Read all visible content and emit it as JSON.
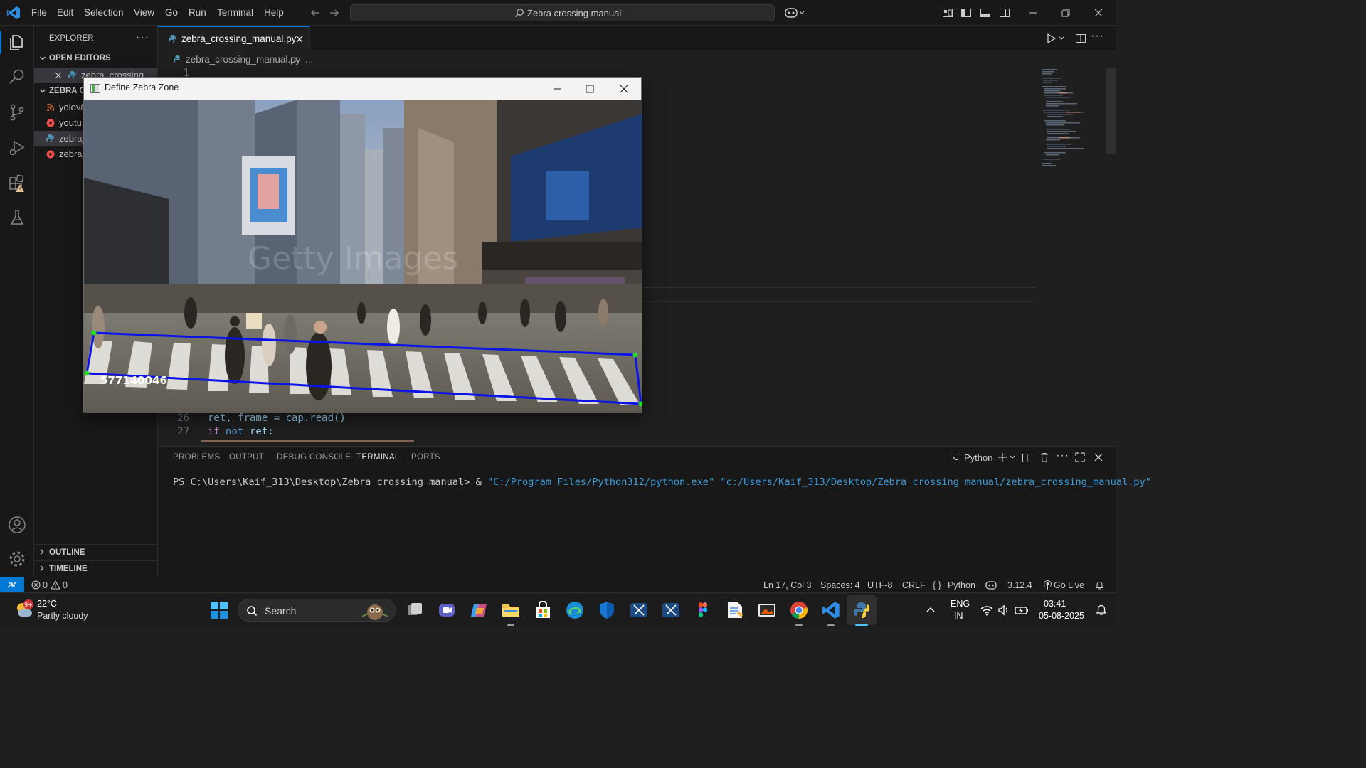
{
  "titlebar": {
    "menu": [
      "File",
      "Edit",
      "Selection",
      "View",
      "Go",
      "Run",
      "Terminal",
      "Help"
    ],
    "search_text": "Zebra crossing manual"
  },
  "sidebar": {
    "explorer_title": "EXPLORER",
    "open_editors_label": "OPEN EDITORS",
    "open_editor_file": "zebra_crossing",
    "folder_label": "ZEBRA CR",
    "files": [
      {
        "name": "yolov8",
        "icon": "rss-icon",
        "color": "#e37933"
      },
      {
        "name": "youtu",
        "icon": "video-icon",
        "color": "#f14c4c"
      },
      {
        "name": "zebra_",
        "icon": "python-icon",
        "color": "#519aba"
      },
      {
        "name": "zebra_",
        "icon": "video-icon",
        "color": "#f14c4c"
      }
    ],
    "outline_label": "OUTLINE",
    "timeline_label": "TIMELINE"
  },
  "editor": {
    "tab_label": "zebra_crossing_manual.py",
    "breadcrumb_file": "zebra_crossing_manual.py",
    "breadcrumb_more": "...",
    "line_first": "1",
    "lines": [
      {
        "num": "26",
        "text_a": "ret, frame = cap.read()"
      },
      {
        "num": "27",
        "kw1": "if",
        "kw2": "not",
        "rest": "ret:"
      }
    ]
  },
  "panel": {
    "tabs": [
      "PROBLEMS",
      "OUTPUT",
      "DEBUG CONSOLE",
      "TERMINAL",
      "PORTS"
    ],
    "active_tab": "TERMINAL",
    "shell_label": "Python",
    "prompt": "PS C:\\Users\\Kaif_313\\Desktop\\Zebra crossing manual> & ",
    "cmd_exe": "\"C:/Program Files/Python312/python.exe\"",
    "cmd_script": "\"c:/Users/Kaif_313/Desktop/Zebra crossing manual/zebra_crossing_manual.py\""
  },
  "statusbar": {
    "errors": "0",
    "warnings": "0",
    "position": "Ln 17, Col 3",
    "spaces": "Spaces: 4",
    "encoding": "UTF-8",
    "eol": "CRLF",
    "language": "Python",
    "python_version": "3.12.4",
    "go_live": "Go Live"
  },
  "cv_window": {
    "title": "Define Zebra Zone",
    "overlay_text": "577140046",
    "watermark": "Getty Images",
    "zone_color": "#0b14e8",
    "corner_color": "#22dd22"
  },
  "taskbar": {
    "weather_temp": "22°C",
    "weather_desc": "Partly cloudy",
    "weather_badge": "9+",
    "search_label": "Search",
    "lang_top": "ENG",
    "lang_bottom": "IN",
    "time": "03:41",
    "date": "05-08-2025"
  }
}
